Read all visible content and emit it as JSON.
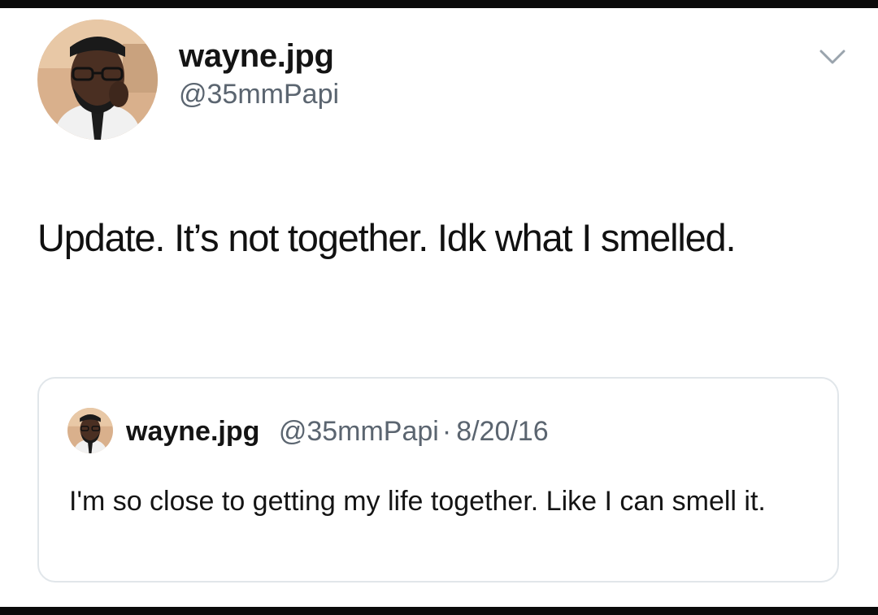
{
  "tweet": {
    "author": {
      "display_name": "wayne.jpg",
      "handle": "@35mmPapi",
      "avatar_icon": "user-avatar-photo"
    },
    "menu_icon": "chevron-down-icon",
    "text": "Update. It’s not together. Idk what I smelled."
  },
  "quoted_tweet": {
    "author": {
      "display_name": "wayne.jpg",
      "handle": "@35mmPapi",
      "avatar_icon": "user-avatar-photo"
    },
    "separator": "·",
    "date": "8/20/16",
    "text": "I'm so close to getting my life together.  Like I can smell it."
  },
  "colors": {
    "background": "#ffffff",
    "frame": "#0a0a0a",
    "secondary_text": "#5b6570",
    "quote_border": "#e1e6ea"
  }
}
